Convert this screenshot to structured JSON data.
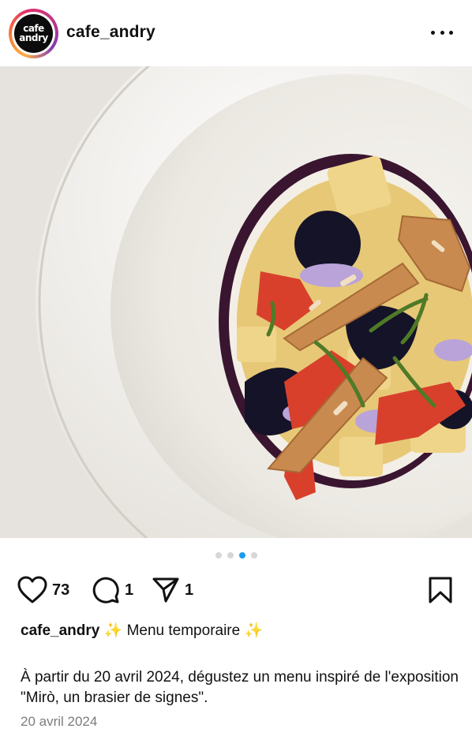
{
  "header": {
    "avatar_line1": "cafe",
    "avatar_line2": "andry",
    "username": "cafe_andry",
    "more_icon": "more-horizontal-icon"
  },
  "post": {
    "image_subject": "plated dessert",
    "carousel": {
      "count": 4,
      "active_index": 2
    }
  },
  "actions": {
    "like_count": "73",
    "comment_count": "1",
    "share_count": "1"
  },
  "caption": {
    "username": "cafe_andry",
    "sparkle_left": "✨",
    "title": "Menu temporaire",
    "sparkle_right": "✨",
    "description": "À partir du 20 avril 2024, dégustez un menu inspiré de l'exposition \"Mirò, un brasier de signes\".",
    "date": "20 avril 2024"
  },
  "colors": {
    "active_dot": "#1d9bf0",
    "date_text": "#7c7c7c"
  }
}
